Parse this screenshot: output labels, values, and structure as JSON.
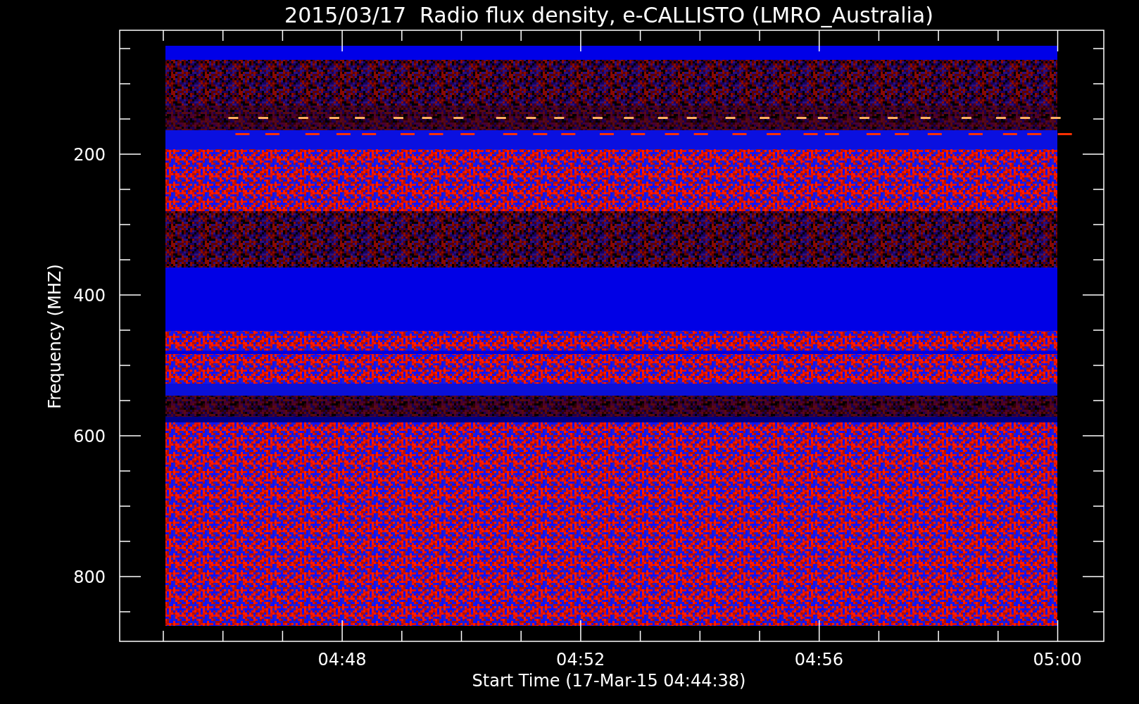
{
  "title": "2015/03/17  Radio flux density, e-CALLISTO (LMRO_Australia)",
  "y_axis": {
    "label": "Frequency (MHZ)",
    "ticks": [
      "200",
      "400",
      "600",
      "800"
    ]
  },
  "x_axis": {
    "label": "Start Time (17-Mar-15 04:44:38)",
    "ticks": [
      "04:48",
      "04:52",
      "04:56",
      "05:00"
    ]
  }
}
